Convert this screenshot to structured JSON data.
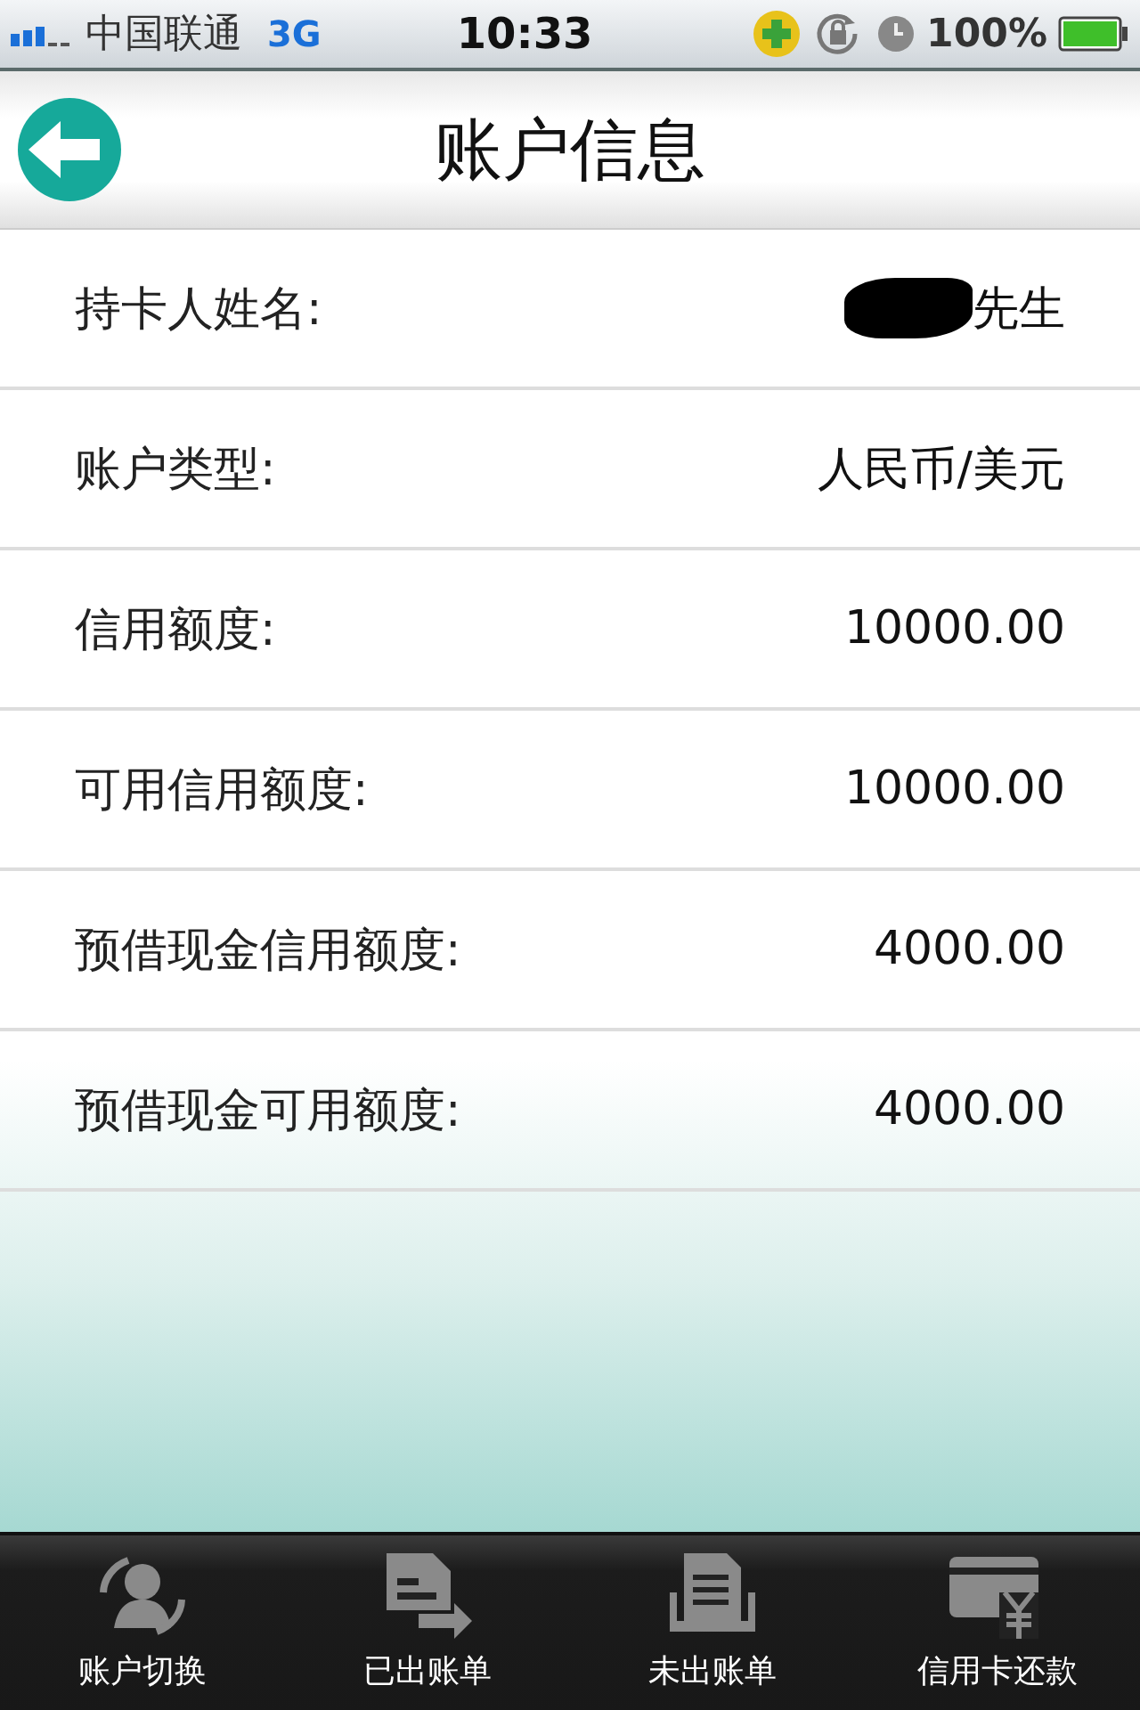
{
  "status_bar": {
    "carrier": "中国联通",
    "network": "3G",
    "time": "10:33",
    "battery": "100%"
  },
  "nav": {
    "title": "账户信息"
  },
  "rows": [
    {
      "label": "持卡人姓名:",
      "value": "先生",
      "redacted": true
    },
    {
      "label": "账户类型:",
      "value": "人民币/美元",
      "redacted": false
    },
    {
      "label": "信用额度:",
      "value": "10000.00",
      "redacted": false
    },
    {
      "label": "可用信用额度:",
      "value": "10000.00",
      "redacted": false
    },
    {
      "label": "预借现金信用额度:",
      "value": "4000.00",
      "redacted": false
    },
    {
      "label": "预借现金可用额度:",
      "value": "4000.00",
      "redacted": false
    }
  ],
  "tab_bar": [
    {
      "label": "账户切换",
      "kind": "switch"
    },
    {
      "label": "已出账单",
      "kind": "billed"
    },
    {
      "label": "未出账单",
      "kind": "unbilled"
    },
    {
      "label": "信用卡还款",
      "kind": "repay"
    }
  ]
}
